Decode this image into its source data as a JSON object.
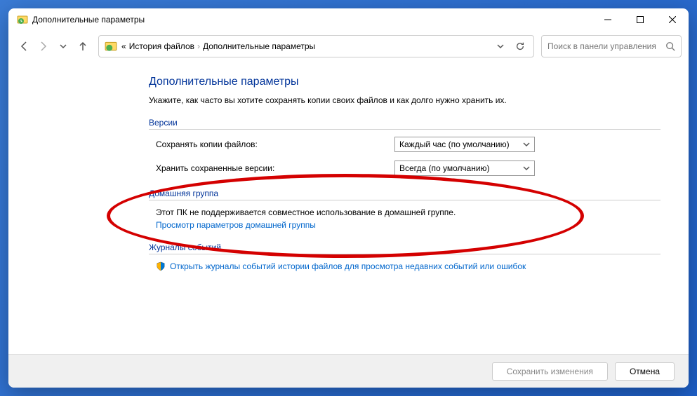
{
  "window": {
    "title": "Дополнительные параметры"
  },
  "breadcrumb": {
    "prefix": "«",
    "items": [
      "История файлов",
      "Дополнительные параметры"
    ]
  },
  "search": {
    "placeholder": "Поиск в панели управления"
  },
  "page": {
    "title": "Дополнительные параметры",
    "subtitle": "Укажите, как часто вы хотите сохранять копии своих файлов и как долго нужно хранить их."
  },
  "versions": {
    "heading": "Версии",
    "save_label": "Сохранять копии файлов:",
    "save_value": "Каждый час (по умолчанию)",
    "keep_label": "Хранить сохраненные версии:",
    "keep_value": "Всегда (по умолчанию)"
  },
  "homegroup": {
    "heading": "Домашняя группа",
    "text": "Этот ПК не поддерживается совместное использование в домашней группе.",
    "link": "Просмотр параметров домашней группы"
  },
  "eventlog": {
    "heading": "Журналы событий",
    "link": "Открыть журналы событий истории файлов для просмотра недавних событий или ошибок"
  },
  "footer": {
    "save": "Сохранить изменения",
    "cancel": "Отмена"
  }
}
